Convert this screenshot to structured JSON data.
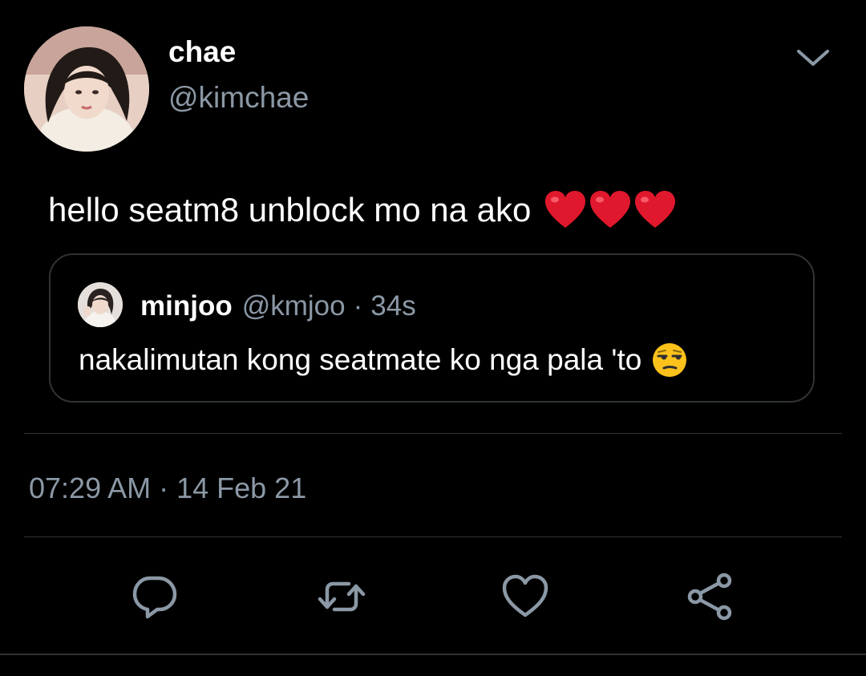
{
  "tweet": {
    "author": {
      "display_name": "chae",
      "handle": "@kimchae"
    },
    "text": "hello seatm8 unblock mo na ako",
    "text_emoji": [
      "red-heart",
      "red-heart",
      "red-heart"
    ],
    "quoted": {
      "display_name": "minjoo",
      "handle": "@kmjoo",
      "separator": "·",
      "time": "34s",
      "text": "nakalimutan kong seatmate ko nga pala 'to",
      "text_emoji": "unamused-face"
    },
    "timestamp": "07:29 AM · 14 Feb 21"
  },
  "actions": [
    {
      "name": "reply",
      "icon": "reply-icon"
    },
    {
      "name": "retweet",
      "icon": "retweet-icon"
    },
    {
      "name": "like",
      "icon": "heart-icon"
    },
    {
      "name": "share",
      "icon": "share-icon"
    }
  ],
  "colors": {
    "background": "#000000",
    "text_primary": "#ffffff",
    "text_secondary": "#8b98a5",
    "border": "#2f3336",
    "heart_red": "#e0182d",
    "emoji_yellow": "#fcc21b"
  }
}
